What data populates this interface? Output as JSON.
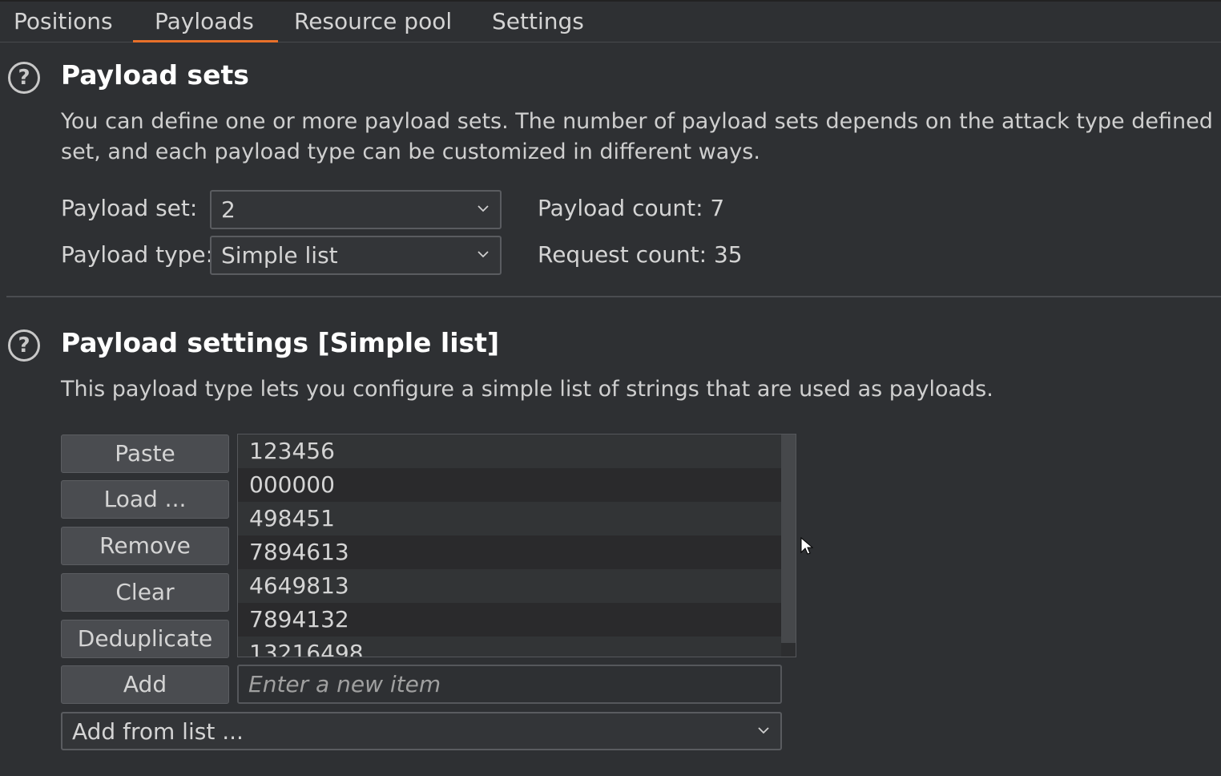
{
  "tabs": [
    {
      "label": "Positions",
      "active": false
    },
    {
      "label": "Payloads",
      "active": true
    },
    {
      "label": "Resource pool",
      "active": false
    },
    {
      "label": "Settings",
      "active": false
    }
  ],
  "colors": {
    "accent": "#e8702a",
    "background": "#2e3033"
  },
  "payload_sets": {
    "title": "Payload sets",
    "description_line1": "You can define one or more payload sets. The number of payload sets depends on the attack type defined in",
    "description_line2": "set, and each payload type can be customized in different ways.",
    "payload_set_label": "Payload set:",
    "payload_set_value": "2",
    "payload_type_label": "Payload type:",
    "payload_type_value": "Simple list",
    "payload_count": "Payload count:  7",
    "request_count": "Request count: 35"
  },
  "payload_settings": {
    "title": "Payload settings [Simple list]",
    "description": "This payload type lets you configure a simple list of strings that are used as payloads.",
    "buttons": {
      "paste": "Paste",
      "load": "Load ...",
      "remove": "Remove",
      "clear": "Clear",
      "deduplicate": "Deduplicate",
      "add": "Add"
    },
    "items": [
      "123456",
      "000000",
      "498451",
      "7894613",
      "4649813",
      "7894132",
      "13216498"
    ],
    "new_item_placeholder": "Enter a new item",
    "add_from_list": "Add from list ..."
  },
  "icons": [
    "help-icon",
    "chevron-down-icon",
    "mouse-cursor-icon"
  ]
}
